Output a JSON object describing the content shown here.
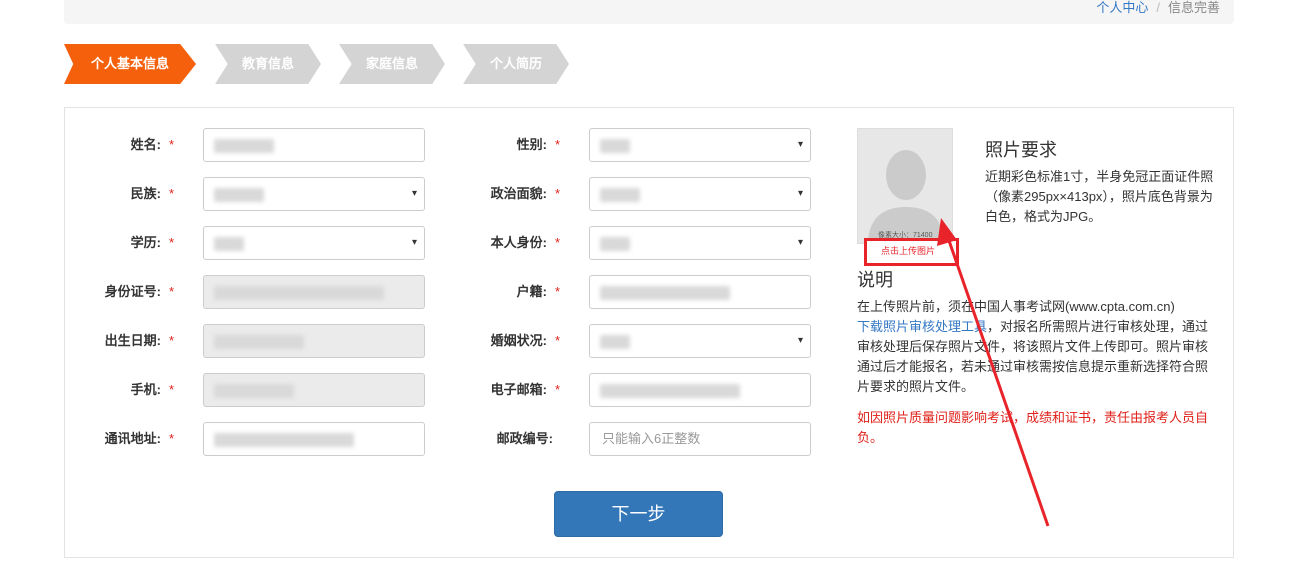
{
  "breadcrumb": {
    "home": "个人中心",
    "separator": "/",
    "current": "信息完善"
  },
  "steps": [
    {
      "label": "个人基本信息",
      "state": "active"
    },
    {
      "label": "教育信息",
      "state": "inactive"
    },
    {
      "label": "家庭信息",
      "state": "inactive"
    },
    {
      "label": "个人简历",
      "state": "inactive"
    }
  ],
  "form": {
    "required_mark": "*",
    "name_label": "姓名:",
    "ethnicity_label": "民族:",
    "education_label": "学历:",
    "id_number_label": "身份证号:",
    "birth_date_label": "出生日期:",
    "phone_label": "手机:",
    "address_label": "通讯地址:",
    "gender_label": "性别:",
    "political_label": "政治面貌:",
    "identity_label": "本人身份:",
    "household_label": "户籍:",
    "marital_label": "婚姻状况:",
    "email_label": "电子邮箱:",
    "postcode_label": "邮政编号:",
    "postcode_placeholder": "只能输入6正整数",
    "select_caret": "▾"
  },
  "next_button": "下一步",
  "photo": {
    "footer_text": "像素大小：71400",
    "upload_label": "点击上传图片",
    "requirements_title": "照片要求",
    "requirements_text": "近期彩色标准1寸，半身免冠正面证件照（像素295px×413px），照片底色背景为白色，格式为JPG。"
  },
  "notes": {
    "title": "说明",
    "text_before": "在上传照片前，须在中国人事考试网(www.cpta.com.cn)",
    "link": "下载照片审核处理工具",
    "text_after": "，对报名所需照片进行审核处理，通过审核处理后保存照片文件，将该照片文件上传即可。照片审核通过后才能报名，若未通过审核需按信息提示重新选择符合照片要求的照片文件。",
    "warning": "如因照片质量问题影响考试，成绩和证书，责任由报考人员自负。"
  },
  "colors": {
    "accent_orange": "#f4600c",
    "inactive_step": "#d4d4d4",
    "primary_blue": "#3477b8",
    "link_blue": "#3478c4",
    "required_red": "#e0201a",
    "annotation_red": "#e8232a"
  }
}
